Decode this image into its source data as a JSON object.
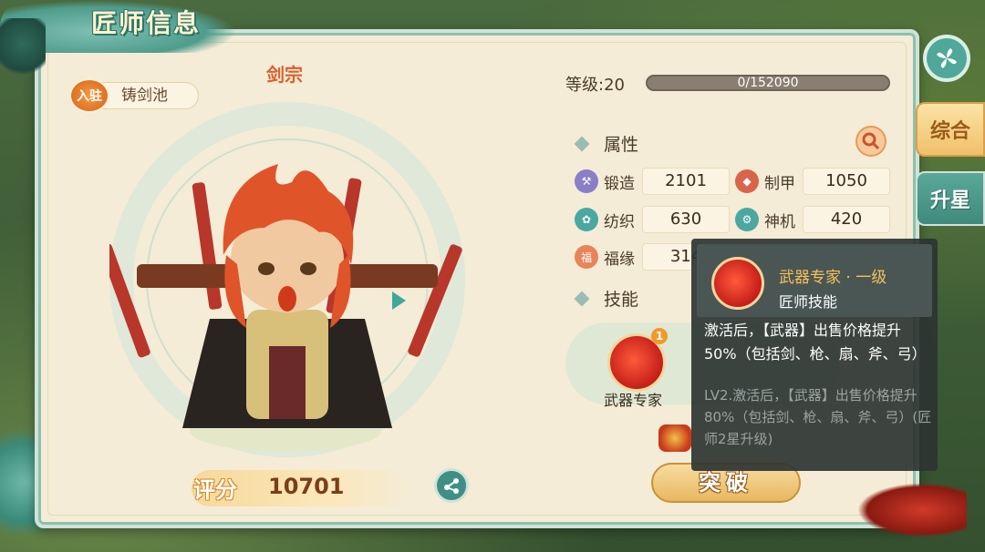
{
  "header": {
    "title": "匠师信息"
  },
  "craftsman": {
    "name": "剑宗",
    "join_badge": "入驻",
    "join_place": "铸剑池",
    "score_label": "评分",
    "score_value": "10701"
  },
  "level": {
    "label": "等级:20",
    "exp_text": "0/152090",
    "exp_progress": 0
  },
  "attributes": {
    "section_title": "属性",
    "items": [
      {
        "name": "锻造",
        "value": "2101",
        "icon": "anvil-icon",
        "color": "#8a7ec8"
      },
      {
        "name": "制甲",
        "value": "1050",
        "icon": "armor-icon",
        "color": "#d8654a"
      },
      {
        "name": "纺织",
        "value": "630",
        "icon": "thread-icon",
        "color": "#4aa8a0"
      },
      {
        "name": "神机",
        "value": "420",
        "icon": "gear-icon",
        "color": "#4aa8a0"
      },
      {
        "name": "福缘",
        "value": "314",
        "icon": "fortune-icon",
        "color": "#e8845a"
      }
    ]
  },
  "skills": {
    "section_title": "技能",
    "items": [
      {
        "name": "武器专家",
        "level_badge": "1"
      }
    ],
    "breakthrough_label": "突破"
  },
  "tooltip": {
    "title": "武器专家 · 一级",
    "subtitle": "匠师技能",
    "description": "激活后，【武器】出售价格提升50%（包括剑、枪、扇、斧、弓）",
    "next_level": "LV2.激活后，【武器】出售价格提升80%（包括剑、枪、扇、斧、弓）(匠师2星升级)"
  },
  "side_tabs": [
    {
      "label": "综合",
      "active": true
    },
    {
      "label": "升星",
      "active": false
    }
  ],
  "colors": {
    "panel_bg": "#f4ecd6",
    "accent_teal": "#4fa89a",
    "accent_orange": "#d9602e"
  }
}
